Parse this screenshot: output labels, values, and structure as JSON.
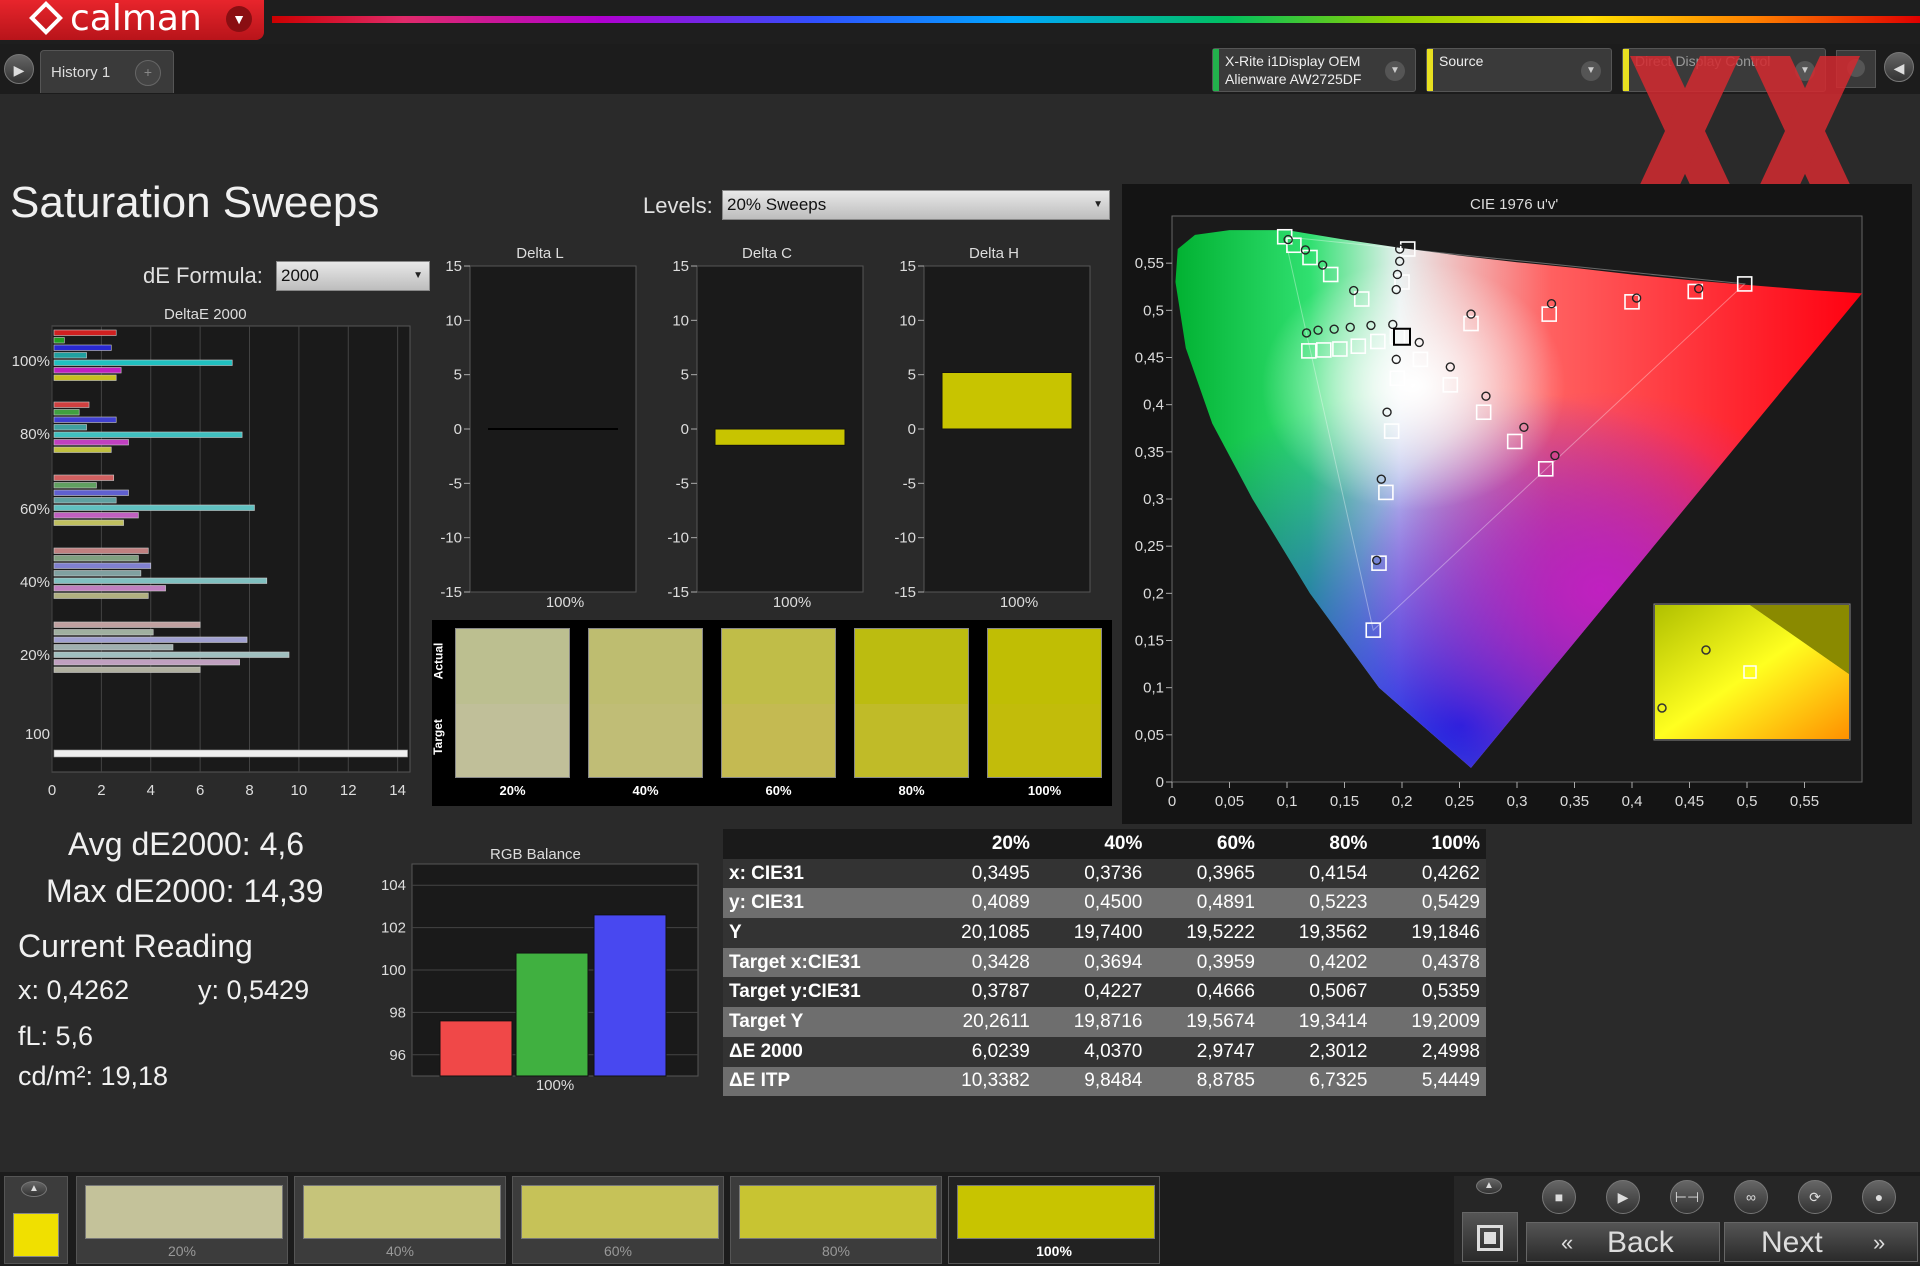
{
  "app": {
    "logo": "calman",
    "logo_menu_icon": "chevron-down-icon"
  },
  "tabs": {
    "active": "History 1",
    "add_icon": "plus-icon"
  },
  "sources": [
    {
      "line1": "X-Rite i1Display OEM",
      "line2": "Alienware AW2725DF",
      "color": "#22b14c"
    },
    {
      "line1": "Source",
      "line2": "",
      "color": "#e8e020"
    },
    {
      "line1": "Direct Display Control",
      "line2": "",
      "color": "#e8e020"
    }
  ],
  "page": {
    "title": "Saturation Sweeps"
  },
  "levels": {
    "label": "Levels:",
    "value": "20% Sweeps"
  },
  "formula": {
    "label": "dE Formula:",
    "value": "2000"
  },
  "deltae_chart": {
    "title": "DeltaE 2000",
    "x_ticks": [
      "0",
      "2",
      "4",
      "6",
      "8",
      "10",
      "12",
      "14"
    ],
    "xlim": [
      0,
      14.5
    ],
    "categories": [
      "100%",
      "80%",
      "60%",
      "40%",
      "20%",
      "100"
    ],
    "groups": [
      {
        "label": "100%",
        "values": [
          2.6,
          0.5,
          2.4,
          1.4,
          7.3,
          2.8,
          2.6
        ],
        "colors": [
          "#d02020",
          "#20a020",
          "#2828d0",
          "#20a0a0",
          "#20c0c0",
          "#c020c0",
          "#c8c020"
        ]
      },
      {
        "label": "80%",
        "values": [
          1.5,
          1.1,
          2.6,
          1.4,
          7.7,
          3.1,
          2.4
        ],
        "colors": [
          "#d04040",
          "#40a040",
          "#4040d0",
          "#40a0a0",
          "#40c0c0",
          "#c040c0",
          "#c0c040"
        ]
      },
      {
        "label": "60%",
        "values": [
          2.5,
          1.8,
          3.1,
          2.6,
          8.2,
          3.5,
          2.9
        ],
        "colors": [
          "#d06060",
          "#60a060",
          "#6060d0",
          "#60a0a0",
          "#60c0c0",
          "#c060c0",
          "#c0c060"
        ]
      },
      {
        "label": "40%",
        "values": [
          3.9,
          3.5,
          4.0,
          3.6,
          8.7,
          4.6,
          3.9
        ],
        "colors": [
          "#c08080",
          "#80a080",
          "#8080d0",
          "#80a0a0",
          "#80c0c0",
          "#c080c0",
          "#b0b080"
        ]
      },
      {
        "label": "20%",
        "values": [
          6.0,
          4.1,
          7.9,
          4.9,
          9.6,
          7.6,
          6.0
        ],
        "colors": [
          "#c0a0a0",
          "#a0b0a0",
          "#a0a0d0",
          "#a0b0b0",
          "#a0c0c0",
          "#c0a0c0",
          "#b0b0a0"
        ]
      }
    ],
    "grayscale": {
      "label": "100",
      "value": 14.4,
      "color": "#f0f0f0"
    }
  },
  "delta_charts": [
    {
      "title": "Delta L",
      "value": 0.0,
      "category": "100%",
      "ylim": [
        -15,
        15
      ],
      "ticks": [
        "15",
        "10",
        "5",
        "0",
        "-5",
        "-10",
        "-15"
      ]
    },
    {
      "title": "Delta C",
      "value": -1.5,
      "category": "100%",
      "ylim": [
        -15,
        15
      ],
      "ticks": [
        "15",
        "10",
        "5",
        "0",
        "-5",
        "-10",
        "-15"
      ]
    },
    {
      "title": "Delta H",
      "value": 5.2,
      "category": "100%",
      "ylim": [
        -15,
        15
      ],
      "ticks": [
        "15",
        "10",
        "5",
        "0",
        "-5",
        "-10",
        "-15"
      ]
    }
  ],
  "swatches": {
    "actual_label": "Actual",
    "target_label": "Target",
    "items": [
      {
        "label": "20%",
        "actual": "#bcbf90",
        "target": "#c0bf99"
      },
      {
        "label": "40%",
        "actual": "#bebd70",
        "target": "#c0bd76"
      },
      {
        "label": "60%",
        "actual": "#c0bd48",
        "target": "#c4ba52"
      },
      {
        "label": "80%",
        "actual": "#bcbc10",
        "target": "#c0bb28"
      },
      {
        "label": "100%",
        "actual": "#c0be04",
        "target": "#c2bc0a"
      }
    ]
  },
  "cie": {
    "title": "CIE 1976 u'v'",
    "x_ticks": [
      "0",
      "0,05",
      "0,1",
      "0,15",
      "0,2",
      "0,25",
      "0,3",
      "0,35",
      "0,4",
      "0,45",
      "0,5",
      "0,55"
    ],
    "y_ticks": [
      "0",
      "0,05",
      "0,1",
      "0,15",
      "0,2",
      "0,25",
      "0,3",
      "0,35",
      "0,4",
      "0,45",
      "0,5",
      "0,55"
    ],
    "xlim": [
      0,
      0.6
    ],
    "ylim": [
      0,
      0.6
    ],
    "targets": [
      [
        0.098,
        0.578
      ],
      [
        0.106,
        0.569
      ],
      [
        0.12,
        0.556
      ],
      [
        0.138,
        0.538
      ],
      [
        0.165,
        0.512
      ],
      [
        0.205,
        0.565
      ],
      [
        0.2,
        0.53
      ],
      [
        0.196,
        0.472
      ],
      [
        0.26,
        0.486
      ],
      [
        0.328,
        0.496
      ],
      [
        0.4,
        0.509
      ],
      [
        0.455,
        0.52
      ],
      [
        0.498,
        0.528
      ],
      [
        0.196,
        0.428
      ],
      [
        0.216,
        0.448
      ],
      [
        0.242,
        0.421
      ],
      [
        0.271,
        0.392
      ],
      [
        0.298,
        0.361
      ],
      [
        0.325,
        0.332
      ],
      [
        0.191,
        0.372
      ],
      [
        0.186,
        0.307
      ],
      [
        0.18,
        0.232
      ],
      [
        0.175,
        0.161
      ],
      [
        0.119,
        0.457
      ],
      [
        0.132,
        0.458
      ],
      [
        0.146,
        0.459
      ],
      [
        0.162,
        0.462
      ],
      [
        0.179,
        0.467
      ]
    ],
    "measured": [
      [
        0.101,
        0.575
      ],
      [
        0.116,
        0.564
      ],
      [
        0.131,
        0.548
      ],
      [
        0.158,
        0.521
      ],
      [
        0.198,
        0.565
      ],
      [
        0.198,
        0.552
      ],
      [
        0.196,
        0.538
      ],
      [
        0.195,
        0.522
      ],
      [
        0.192,
        0.485
      ],
      [
        0.26,
        0.496
      ],
      [
        0.33,
        0.507
      ],
      [
        0.404,
        0.513
      ],
      [
        0.458,
        0.523
      ],
      [
        0.195,
        0.448
      ],
      [
        0.215,
        0.466
      ],
      [
        0.242,
        0.44
      ],
      [
        0.273,
        0.409
      ],
      [
        0.306,
        0.376
      ],
      [
        0.333,
        0.346
      ],
      [
        0.187,
        0.392
      ],
      [
        0.182,
        0.321
      ],
      [
        0.178,
        0.235
      ],
      [
        0.117,
        0.476
      ],
      [
        0.127,
        0.479
      ],
      [
        0.141,
        0.48
      ],
      [
        0.155,
        0.482
      ],
      [
        0.173,
        0.484
      ]
    ],
    "current": [
      0.2,
      0.472
    ]
  },
  "stats": {
    "avg": "Avg dE2000: 4,6",
    "max": "Max dE2000: 14,39",
    "current_heading": "Current Reading",
    "x": "x: 0,4262",
    "y": "y: 0,5429",
    "fl": "fL: 5,6",
    "cdm": "cd/m²: 19,18"
  },
  "rgb_balance": {
    "title": "RGB Balance",
    "category": "100%",
    "ylim": [
      95,
      105
    ],
    "ticks": [
      "104",
      "102",
      "100",
      "98",
      "96"
    ],
    "series": [
      {
        "value": 97.6,
        "color": "#f04848"
      },
      {
        "value": 100.8,
        "color": "#40b040"
      },
      {
        "value": 102.6,
        "color": "#4848f0"
      }
    ]
  },
  "table": {
    "headers": [
      "",
      "20%",
      "40%",
      "60%",
      "80%",
      "100%"
    ],
    "rows": [
      [
        "x: CIE31",
        "0,3495",
        "0,3736",
        "0,3965",
        "0,4154",
        "0,4262"
      ],
      [
        "y: CIE31",
        "0,4089",
        "0,4500",
        "0,4891",
        "0,5223",
        "0,5429"
      ],
      [
        "Y",
        "20,1085",
        "19,7400",
        "19,5222",
        "19,3562",
        "19,1846"
      ],
      [
        "Target x:CIE31",
        "0,3428",
        "0,3694",
        "0,3959",
        "0,4202",
        "0,4378"
      ],
      [
        "Target y:CIE31",
        "0,3787",
        "0,4227",
        "0,4666",
        "0,5067",
        "0,5359"
      ],
      [
        "Target Y",
        "20,2611",
        "19,8716",
        "19,5674",
        "19,3414",
        "19,2009"
      ],
      [
        "ΔE 2000",
        "6,0239",
        "4,0370",
        "2,9747",
        "2,3012",
        "2,4998"
      ],
      [
        "ΔE ITP",
        "10,3382",
        "9,8484",
        "8,8785",
        "6,7325",
        "5,4449"
      ]
    ]
  },
  "bottom": {
    "current_color": "#f0e000",
    "swatches": [
      {
        "label": "20%",
        "color": "#c4c29a"
      },
      {
        "label": "40%",
        "color": "#c6c47a"
      },
      {
        "label": "60%",
        "color": "#c6c258"
      },
      {
        "label": "80%",
        "color": "#c8c432"
      },
      {
        "label": "100%",
        "color": "#c8c400"
      }
    ],
    "back": "Back",
    "next": "Next",
    "controls": [
      "stop-icon",
      "play-icon",
      "fit-icon",
      "loop-icon",
      "refresh-icon",
      "circle-icon"
    ]
  }
}
